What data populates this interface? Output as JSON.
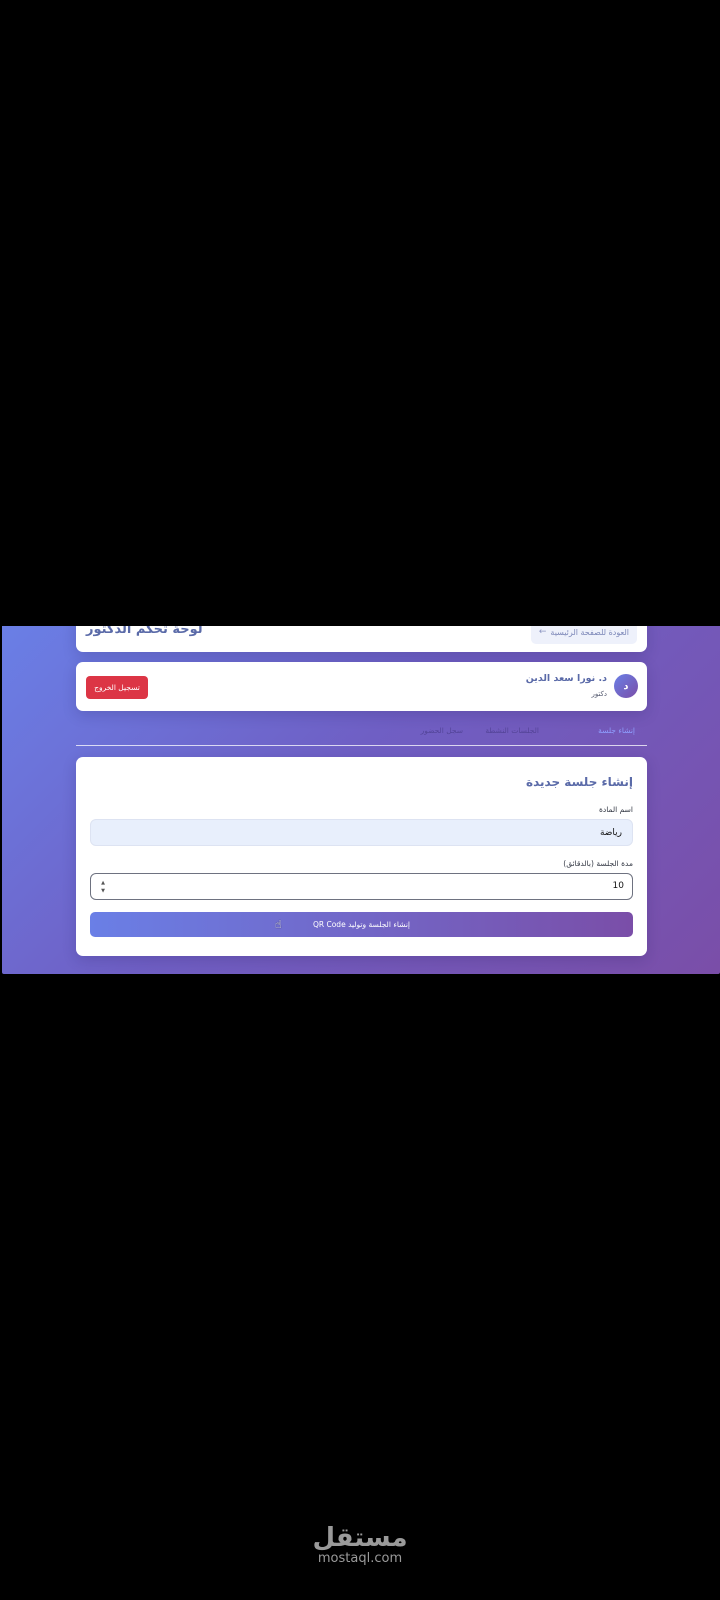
{
  "header": {
    "title": "لوحة تحكم الدكتور",
    "back_button_label": "العودة للصفحة الرئيسية",
    "back_icon": "←"
  },
  "user": {
    "avatar_letter": "د",
    "name": "د. نورا سعد الدين",
    "role": "دكتور",
    "logout_label": "تسجيل الخروج"
  },
  "tabs": [
    {
      "label": "إنشاء جلسة",
      "active": true
    },
    {
      "label": "الجلسات النشطة",
      "active": false
    },
    {
      "label": "سجل الحضور",
      "active": false
    }
  ],
  "form": {
    "title": "إنشاء جلسة جديدة",
    "subject_label": "اسم المادة",
    "subject_value": "رياضة",
    "duration_label": "مدة الجلسة (بالدقائق)",
    "duration_value": "10",
    "submit_label": "إنشاء الجلسة وتوليد QR Code"
  },
  "watermark": {
    "arabic": "مستقل",
    "latin": "mostaql.com"
  },
  "colors": {
    "gradient_start": "#6a7fe6",
    "gradient_end": "#7a4ea8",
    "logout": "#dc3545",
    "title_text": "#5a6aa8"
  }
}
